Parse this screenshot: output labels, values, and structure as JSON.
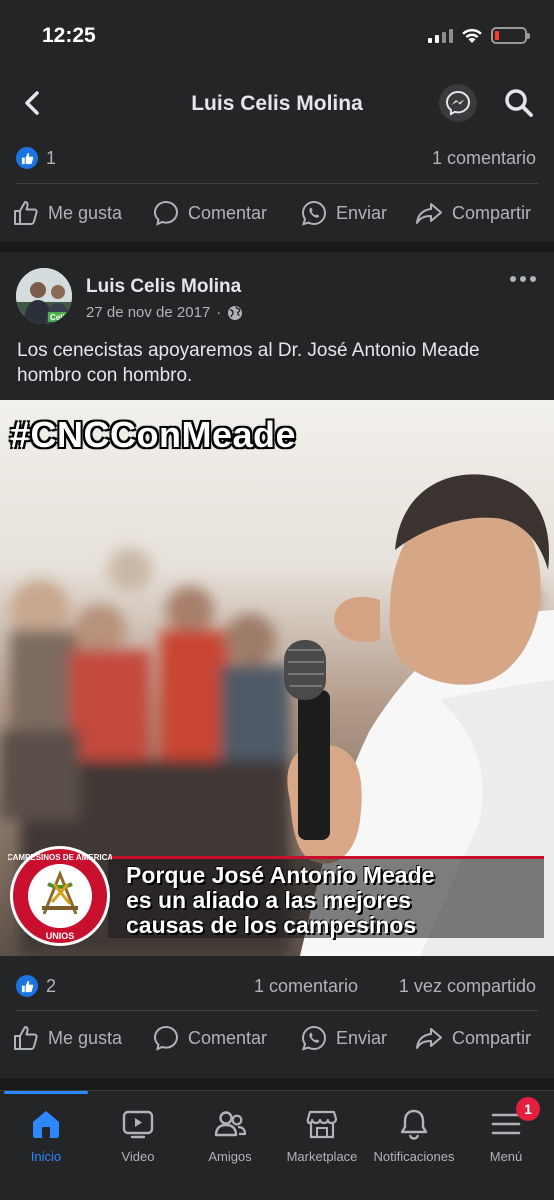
{
  "status": {
    "time": "12:25"
  },
  "nav": {
    "title": "Luis Celis Molina"
  },
  "previous_post": {
    "like_count": "1",
    "comments": "1 comentario",
    "actions": {
      "like": "Me gusta",
      "comment": "Comentar",
      "send": "Enviar",
      "share": "Compartir"
    }
  },
  "post": {
    "author": "Luis Celis Molina",
    "date": "27 de nov de 2017",
    "privacy_icon": "globe-icon",
    "text": "Los cenecistas apoyaremos al Dr. José Antonio Meade hombro con hombro.",
    "image": {
      "hashtag": "#CNCConMeade",
      "caption_line1": "Porque José Antonio Meade",
      "caption_line2": "es un aliado a las mejores",
      "caption_line3": "causas de los campesinos",
      "seal_top": "CAMPESINOS DE AMERICA",
      "seal_bottom": "UNIOS"
    },
    "like_count": "2",
    "comments": "1 comentario",
    "shares": "1 vez compartido",
    "actions": {
      "like": "Me gusta",
      "comment": "Comentar",
      "send": "Enviar",
      "share": "Compartir"
    }
  },
  "avatar_text": "Celis",
  "bottom_nav": {
    "tabs": [
      {
        "label": "Inicio",
        "icon": "home-icon",
        "active": true
      },
      {
        "label": "Video",
        "icon": "video-icon"
      },
      {
        "label": "Amigos",
        "icon": "friends-icon"
      },
      {
        "label": "Marketplace",
        "icon": "marketplace-icon"
      },
      {
        "label": "Notificaciones",
        "icon": "bell-icon"
      },
      {
        "label": "Menú",
        "icon": "menu-icon",
        "badge": "1"
      }
    ]
  },
  "colors": {
    "accent": "#2d88ff",
    "background": "#242526",
    "badge": "#e41e3f"
  }
}
